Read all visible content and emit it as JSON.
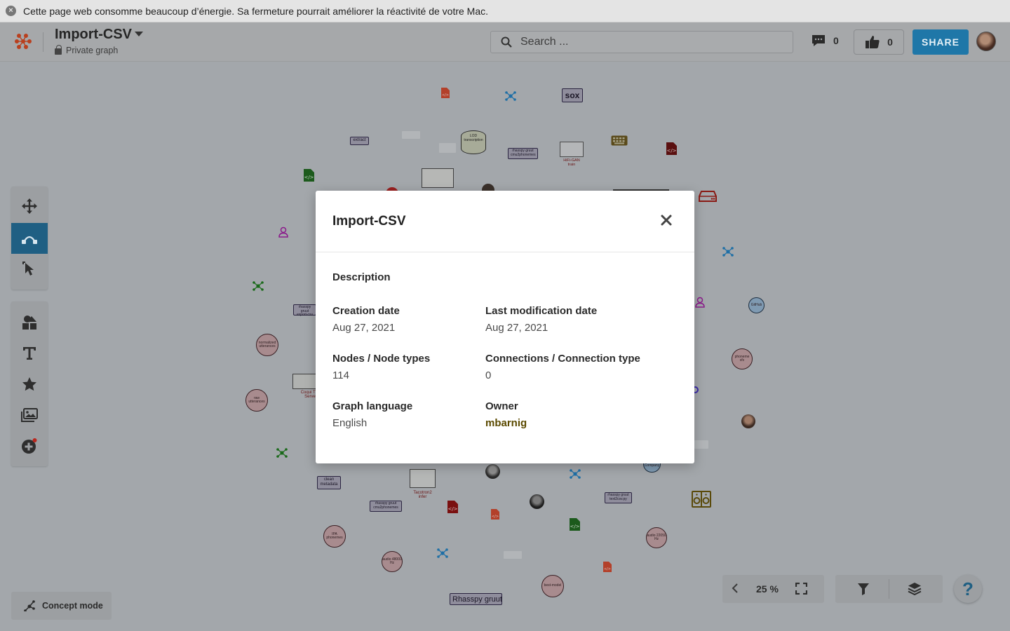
{
  "notification": {
    "text": "Cette page web consomme beaucoup d’énergie. Sa fermeture pourrait améliorer la réactivité de votre Mac."
  },
  "header": {
    "graph_title": "Import-CSV",
    "privacy": "Private graph",
    "search_placeholder": "Search ...",
    "comments_count": "0",
    "likes_count": "0",
    "share_label": "SHARE"
  },
  "canvas": {
    "labels": {
      "sox": "sox",
      "extract": "extract",
      "lod": "LOD transcription",
      "rhasspy_cmu": "rhasspy gruut cmu2phonemes",
      "hifigan": "HiFi-GAN train",
      "rhasspy_export": "rhasspy gruut export-csv",
      "normalized": "normalized utterances",
      "raw": "raw utterances",
      "coqui": "Coqui TTS Server",
      "clean": "clean metadata",
      "tacotron": "Tacotron2 infer",
      "rhasspy_phonemes": "rhasspy gruut cmu2phonemes",
      "rhasspy_text": "rhasspy gruut text2csv.py",
      "ipa": "IPA phonemes",
      "audio48": "audio 48000 Hz",
      "best": "best-model",
      "audio22": "audio 22050 Hz",
      "rhasspy": "Rhasspy gruut",
      "phoneme": "phoneme sfx",
      "github": "GitHub",
      "company": "Company"
    }
  },
  "concept_mode": "Concept mode",
  "zoom": "25 %",
  "help": "?",
  "modal": {
    "title": "Import-CSV",
    "description_label": "Description",
    "creation_label": "Creation date",
    "creation_value": "Aug 27, 2021",
    "modified_label": "Last modification date",
    "modified_value": "Aug 27, 2021",
    "nodes_label": "Nodes / Node types",
    "nodes_value": "114",
    "connections_label": "Connections / Connection type",
    "connections_value": "0",
    "language_label": "Graph language",
    "language_value": "English",
    "owner_label": "Owner",
    "owner_value": "mbarnig"
  },
  "colors": {
    "accent": "#1f77a8",
    "overlay_bg": "#a3a7ab",
    "owner": "#5b4a00"
  }
}
